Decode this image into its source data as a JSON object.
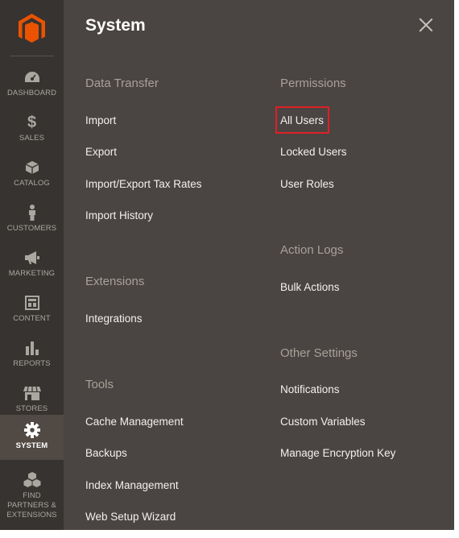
{
  "sidebar": {
    "items": [
      {
        "label": "DASHBOARD",
        "icon": "dashboard-icon"
      },
      {
        "label": "SALES",
        "icon": "dollar-icon"
      },
      {
        "label": "CATALOG",
        "icon": "box-icon"
      },
      {
        "label": "CUSTOMERS",
        "icon": "person-icon"
      },
      {
        "label": "MARKETING",
        "icon": "megaphone-icon"
      },
      {
        "label": "CONTENT",
        "icon": "layout-icon"
      },
      {
        "label": "REPORTS",
        "icon": "bar-chart-icon"
      },
      {
        "label": "STORES",
        "icon": "storefront-icon"
      },
      {
        "label": "SYSTEM",
        "icon": "gear-icon"
      },
      {
        "label": "FIND PARTNERS & EXTENSIONS",
        "icon": "cubes-icon"
      }
    ],
    "active": "SYSTEM"
  },
  "panel": {
    "title": "System",
    "sections": {
      "data_transfer": {
        "title": "Data Transfer",
        "links": [
          "Import",
          "Export",
          "Import/Export Tax Rates",
          "Import History"
        ]
      },
      "extensions": {
        "title": "Extensions",
        "links": [
          "Integrations"
        ]
      },
      "tools": {
        "title": "Tools",
        "links": [
          "Cache Management",
          "Backups",
          "Index Management",
          "Web Setup Wizard"
        ]
      },
      "permissions": {
        "title": "Permissions",
        "links": [
          "All Users",
          "Locked Users",
          "User Roles"
        ]
      },
      "action_logs": {
        "title": "Action Logs",
        "links": [
          "Bulk Actions"
        ]
      },
      "other_settings": {
        "title": "Other Settings",
        "links": [
          "Notifications",
          "Custom Variables",
          "Manage Encryption Key"
        ]
      }
    }
  },
  "colors": {
    "sidebar_bg": "#373330",
    "panel_bg": "#4a4542",
    "active_item_bg": "#514943",
    "logo_orange": "#eb5202",
    "highlight_border": "#e01f26"
  }
}
